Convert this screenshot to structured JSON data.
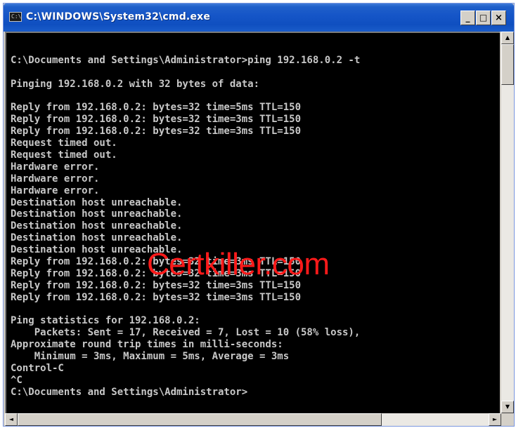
{
  "window": {
    "title": "C:\\WINDOWS\\System32\\cmd.exe",
    "icon_text": "C:\\",
    "buttons": {
      "minimize": "_",
      "maximize": "□",
      "close": "×"
    }
  },
  "console": {
    "lines": [
      "",
      "C:\\Documents and Settings\\Administrator>ping 192.168.0.2 -t",
      "",
      "Pinging 192.168.0.2 with 32 bytes of data:",
      "",
      "Reply from 192.168.0.2: bytes=32 time=5ms TTL=150",
      "Reply from 192.168.0.2: bytes=32 time=3ms TTL=150",
      "Reply from 192.168.0.2: bytes=32 time=3ms TTL=150",
      "Request timed out.",
      "Request timed out.",
      "Hardware error.",
      "Hardware error.",
      "Hardware error.",
      "Destination host unreachable.",
      "Destination host unreachable.",
      "Destination host unreachable.",
      "Destination host unreachable.",
      "Destination host unreachable.",
      "Reply from 192.168.0.2: bytes=32 time=3ms TTL=150",
      "Reply from 192.168.0.2: bytes=32 time=3ms TTL=150",
      "Reply from 192.168.0.2: bytes=32 time=3ms TTL=150",
      "Reply from 192.168.0.2: bytes=32 time=3ms TTL=150",
      "",
      "Ping statistics for 192.168.0.2:",
      "    Packets: Sent = 17, Received = 7, Lost = 10 (58% loss),",
      "Approximate round trip times in milli-seconds:",
      "    Minimum = 3ms, Maximum = 5ms, Average = 3ms",
      "Control-C",
      "^C",
      "C:\\Documents and Settings\\Administrator>"
    ]
  },
  "watermark": {
    "text": "Certkiller.com"
  },
  "scrollbars": {
    "up_arrow": "▲",
    "down_arrow": "▼",
    "left_arrow": "◄",
    "right_arrow": "►"
  },
  "colors": {
    "console_background": "#000000",
    "console_text": "#c8c8c8",
    "titlebar": "#1656c8",
    "watermark": "#ff1a1a"
  }
}
